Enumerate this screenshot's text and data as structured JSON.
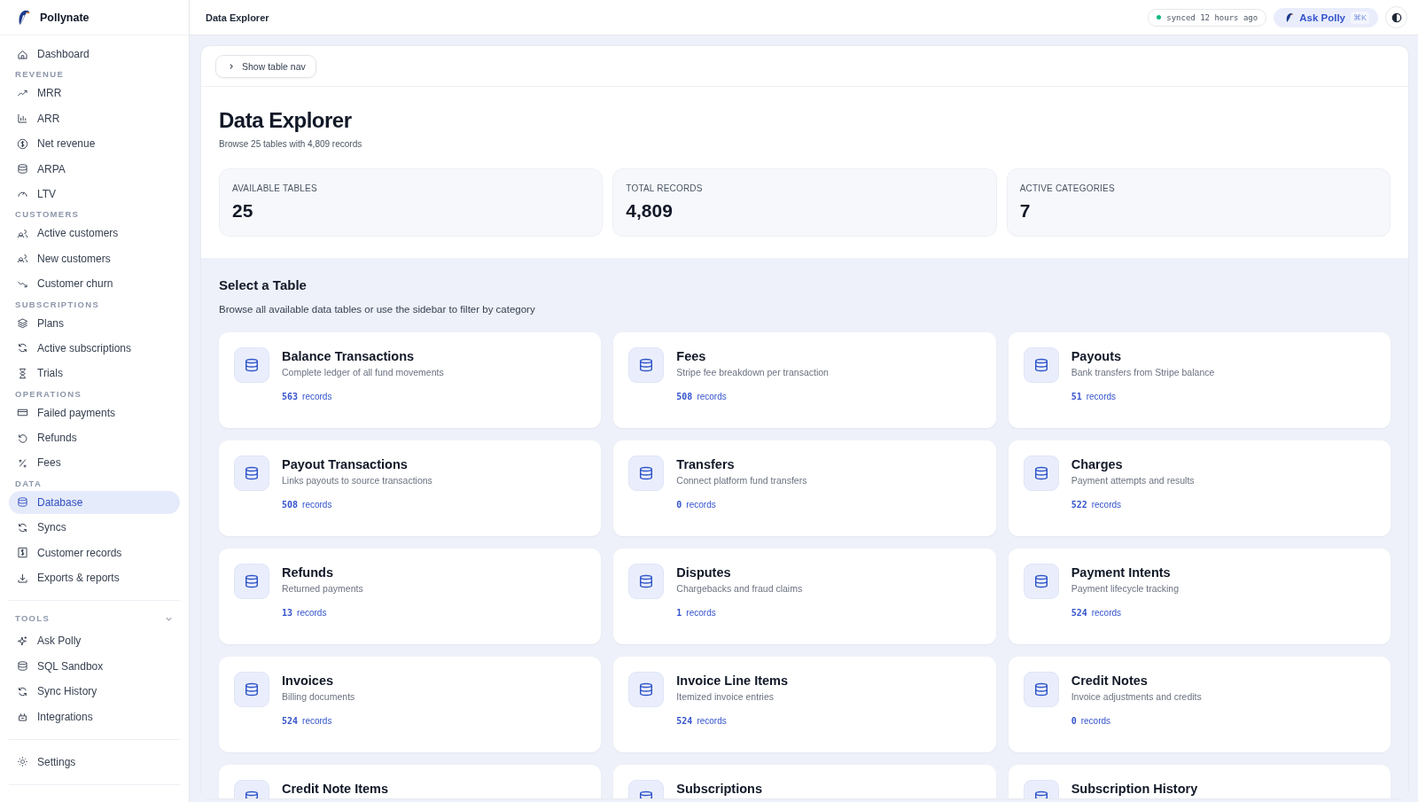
{
  "sidebar": {
    "brand": "Pollynate",
    "nav": [
      {
        "items": [
          {
            "label": "Dashboard",
            "selected": false
          }
        ]
      },
      {
        "heading": "REVENUE",
        "items": [
          {
            "label": "MRR",
            "selected": false
          },
          {
            "label": "ARR",
            "selected": false
          },
          {
            "label": "Net revenue",
            "selected": false
          },
          {
            "label": "ARPA",
            "selected": false
          },
          {
            "label": "LTV",
            "selected": false
          }
        ]
      },
      {
        "heading": "CUSTOMERS",
        "items": [
          {
            "label": "Active customers",
            "selected": false
          },
          {
            "label": "New customers",
            "selected": false
          },
          {
            "label": "Customer churn",
            "selected": false
          }
        ]
      },
      {
        "heading": "SUBSCRIPTIONS",
        "items": [
          {
            "label": "Plans",
            "selected": false
          },
          {
            "label": "Active subscriptions",
            "selected": false
          },
          {
            "label": "Trials",
            "selected": false
          }
        ]
      },
      {
        "heading": "OPERATIONS",
        "items": [
          {
            "label": "Failed payments",
            "selected": false
          },
          {
            "label": "Refunds",
            "selected": false
          },
          {
            "label": "Fees",
            "selected": false
          }
        ]
      },
      {
        "heading": "DATA",
        "items": [
          {
            "label": "Database",
            "selected": true
          },
          {
            "label": "Syncs",
            "selected": false
          },
          {
            "label": "Customer records",
            "selected": false
          },
          {
            "label": "Exports & reports",
            "selected": false
          }
        ]
      }
    ],
    "tools": {
      "heading": "TOOLS",
      "expanded": true,
      "items": [
        {
          "label": "Ask Polly",
          "selected": false
        },
        {
          "label": "SQL Sandbox",
          "selected": false
        },
        {
          "label": "Sync History",
          "selected": false
        },
        {
          "label": "Integrations",
          "selected": false
        }
      ]
    },
    "footer_items": [
      {
        "label": "Settings",
        "selected": false
      }
    ]
  },
  "header": {
    "breadcrumb": "Data Explorer",
    "sync_status": "synced 12 hours ago",
    "ask_button": "Ask Polly",
    "shortcut": "⌘K"
  },
  "toolbar": {
    "nav_button": "Show table nav"
  },
  "page": {
    "title": "Data Explorer",
    "subtitle": "Browse 25 tables with 4,809 records",
    "stats": [
      {
        "label": "AVAILABLE TABLES",
        "value": "25"
      },
      {
        "label": "TOTAL RECORDS",
        "value": "4,809"
      },
      {
        "label": "ACTIVE CATEGORIES",
        "value": "7"
      }
    ]
  },
  "tables_section": {
    "title": "Select a Table",
    "description": "Browse all available data tables or use the sidebar to filter by category",
    "tables": [
      {
        "name": "Balance Transactions",
        "description": "Complete ledger of all fund movements",
        "count": "563",
        "unit": "records"
      },
      {
        "name": "Fees",
        "description": "Stripe fee breakdown per transaction",
        "count": "508",
        "unit": "records"
      },
      {
        "name": "Payouts",
        "description": "Bank transfers from Stripe balance",
        "count": "51",
        "unit": "records"
      },
      {
        "name": "Payout Transactions",
        "description": "Links payouts to source transactions",
        "count": "508",
        "unit": "records"
      },
      {
        "name": "Transfers",
        "description": "Connect platform fund transfers",
        "count": "0",
        "unit": "records"
      },
      {
        "name": "Charges",
        "description": "Payment attempts and results",
        "count": "522",
        "unit": "records"
      },
      {
        "name": "Refunds",
        "description": "Returned payments",
        "count": "13",
        "unit": "records"
      },
      {
        "name": "Disputes",
        "description": "Chargebacks and fraud claims",
        "count": "1",
        "unit": "records"
      },
      {
        "name": "Payment Intents",
        "description": "Payment lifecycle tracking",
        "count": "524",
        "unit": "records"
      },
      {
        "name": "Invoices",
        "description": "Billing documents",
        "count": "524",
        "unit": "records"
      },
      {
        "name": "Invoice Line Items",
        "description": "Itemized invoice entries",
        "count": "524",
        "unit": "records"
      },
      {
        "name": "Credit Notes",
        "description": "Invoice adjustments and credits",
        "count": "0",
        "unit": "records"
      },
      {
        "name": "Credit Note Items"
      },
      {
        "name": "Subscriptions"
      },
      {
        "name": "Subscription History"
      }
    ]
  }
}
